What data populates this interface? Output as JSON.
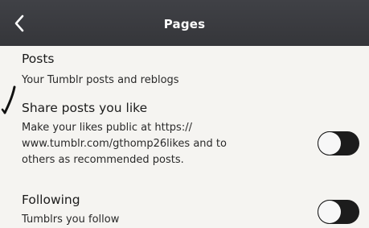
{
  "header": {
    "title": "Pages",
    "back_icon": "chevron-left-icon"
  },
  "settings": [
    {
      "title": "Posts",
      "description_lines": [
        "Your Tumblr posts and reblogs"
      ],
      "toggle": null
    },
    {
      "title": "Share posts you like",
      "description_lines": [
        "Make your likes public at https://",
        "www.tumblr.com/gthomp26likes and to",
        "others as recommended posts."
      ],
      "toggle": {
        "state": "off"
      }
    },
    {
      "title": "Following",
      "description_lines": [
        "Tumblrs you follow"
      ],
      "toggle": {
        "state": "off"
      }
    }
  ],
  "colors": {
    "header_bg": "#3a3b3f",
    "page_bg": "#f5f4f1",
    "toggle_track": "#1c1c1c",
    "toggle_knob": "#f7f7f7"
  }
}
